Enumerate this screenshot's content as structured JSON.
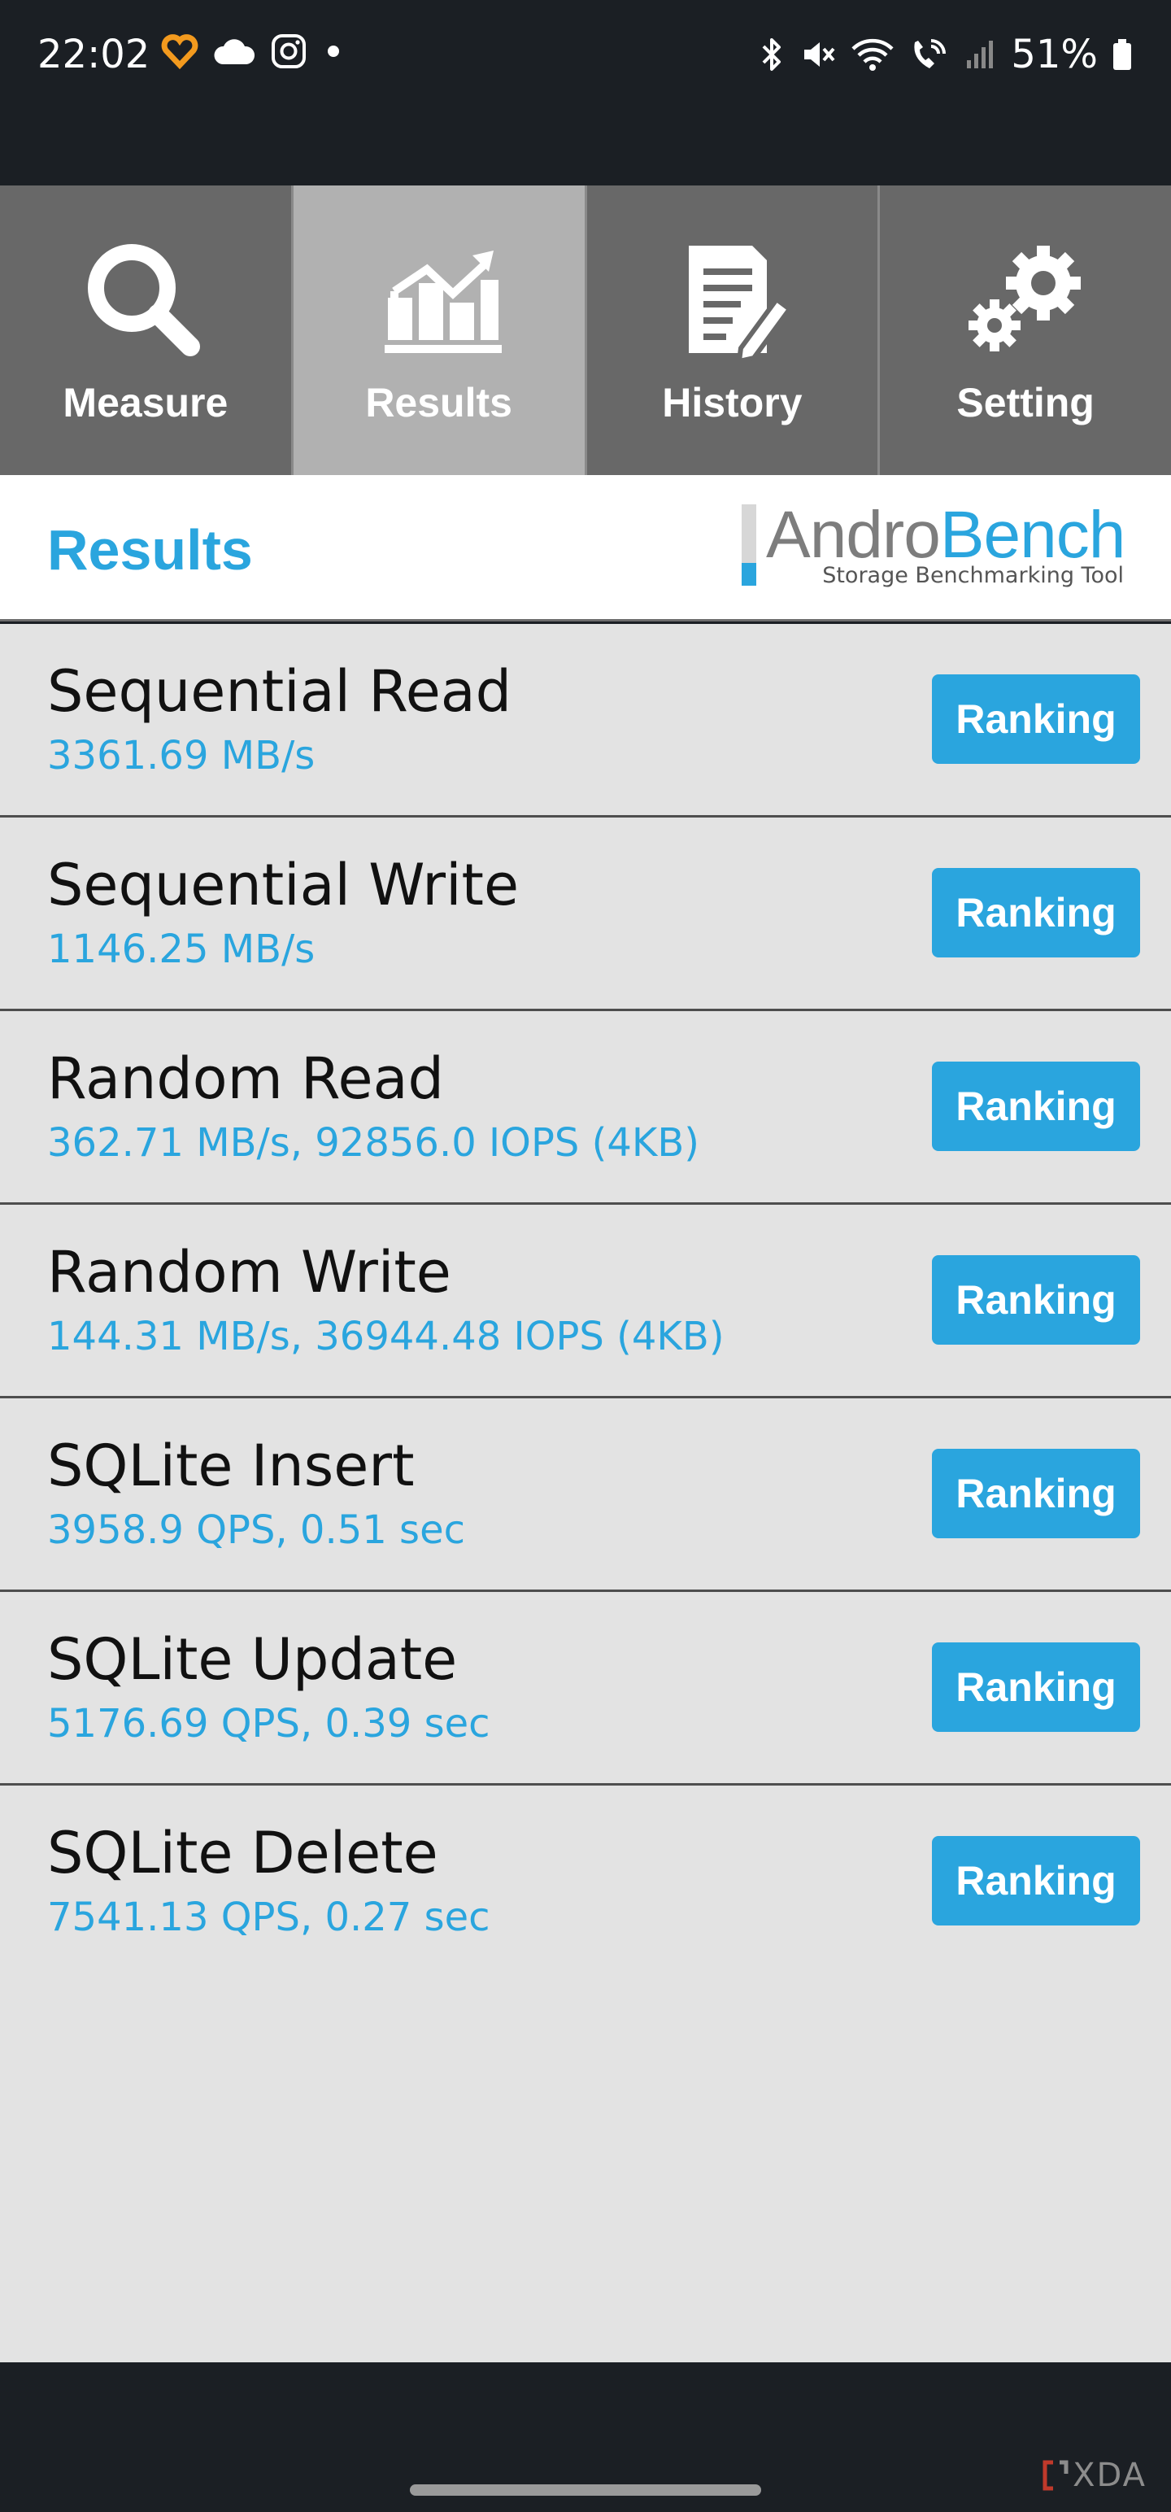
{
  "status_bar": {
    "time": "22:02",
    "battery": "51%",
    "left_icons": [
      "heart-app-icon",
      "cloud-icon",
      "instagram-icon",
      "dot-icon"
    ],
    "right_icons": [
      "bluetooth-icon",
      "mute-icon",
      "wifi-icon",
      "wifi-calling-icon",
      "signal-icon",
      "battery-icon"
    ]
  },
  "tabs": [
    {
      "label": "Measure",
      "icon": "search-icon",
      "active": false
    },
    {
      "label": "Results",
      "icon": "chart-icon",
      "active": true
    },
    {
      "label": "History",
      "icon": "document-icon",
      "active": false
    },
    {
      "label": "Setting",
      "icon": "gears-icon",
      "active": false
    }
  ],
  "header": {
    "title": "Results",
    "logo_andro": "Andro",
    "logo_bench": "Bench",
    "logo_tagline": "Storage Benchmarking Tool"
  },
  "results": [
    {
      "name": "Sequential Read",
      "value": "3361.69 MB/s",
      "button": "Ranking"
    },
    {
      "name": "Sequential Write",
      "value": "1146.25 MB/s",
      "button": "Ranking"
    },
    {
      "name": "Random Read",
      "value": "362.71 MB/s, 92856.0 IOPS (4KB)",
      "button": "Ranking"
    },
    {
      "name": "Random Write",
      "value": "144.31 MB/s, 36944.48 IOPS (4KB)",
      "button": "Ranking"
    },
    {
      "name": "SQLite Insert",
      "value": "3958.9 QPS, 0.51 sec",
      "button": "Ranking"
    },
    {
      "name": "SQLite Update",
      "value": "5176.69 QPS, 0.39 sec",
      "button": "Ranking"
    },
    {
      "name": "SQLite Delete",
      "value": "7541.13 QPS, 0.27 sec",
      "button": "Ranking"
    }
  ],
  "watermark": "XDA",
  "colors": {
    "accent": "#2aa5de",
    "tab_bg": "#686868",
    "tab_active_bg": "#b1b1b1",
    "list_bg": "#e3e3e3"
  }
}
